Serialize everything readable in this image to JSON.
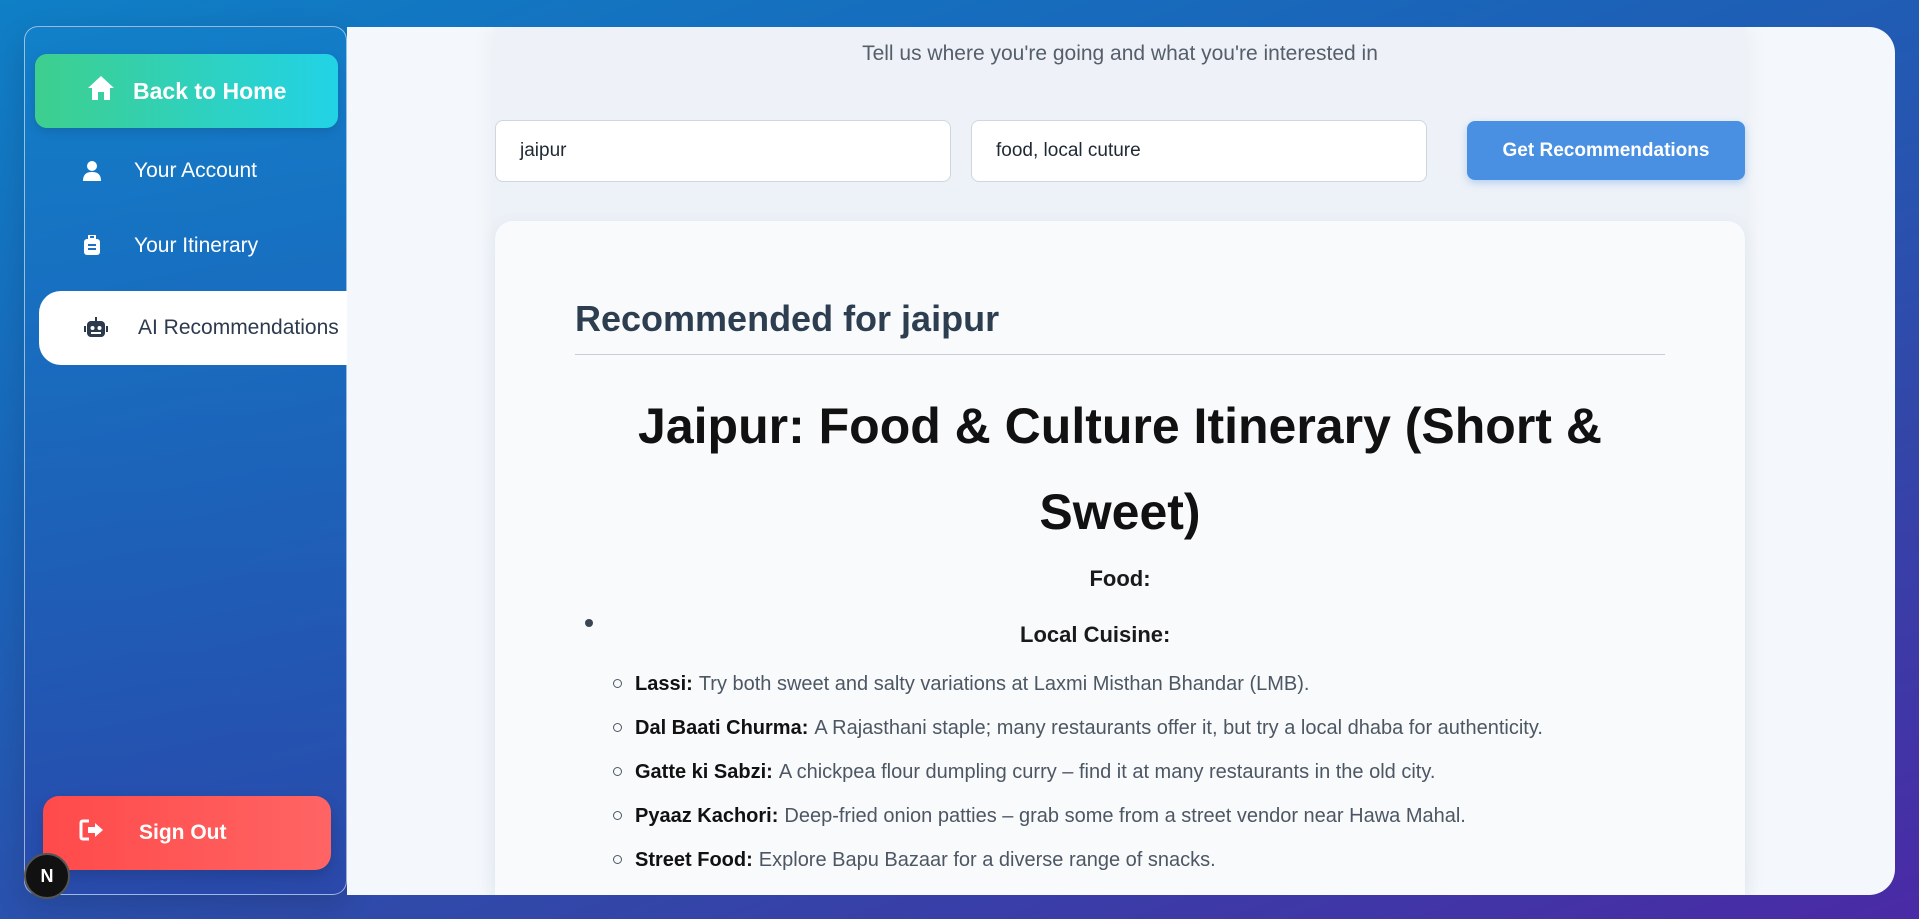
{
  "sidebar": {
    "back_label": "Back to Home",
    "items": [
      {
        "label": "Your Account",
        "icon": "user-icon"
      },
      {
        "label": "Your Itinerary",
        "icon": "luggage-icon"
      },
      {
        "label": "AI Recommendations",
        "icon": "robot-icon",
        "active": true
      }
    ],
    "signout_label": "Sign Out",
    "badge": "N"
  },
  "main": {
    "subtitle": "Tell us where you're going and what you're interested in",
    "destination_value": "jaipur",
    "interests_value": "food, local cuture",
    "get_button": "Get Recommendations",
    "result": {
      "heading": "Recommended for jaipur",
      "doc_title": "Jaipur: Food & Culture Itinerary (Short & Sweet)",
      "food_label": "Food:",
      "cuisine_label": "Local Cuisine:",
      "items": [
        {
          "key": "Lassi:",
          "text": "Try both sweet and salty variations at Laxmi Misthan Bhandar (LMB)."
        },
        {
          "key": "Dal Baati Churma:",
          "text": "A Rajasthani staple; many restaurants offer it, but try a local dhaba for authenticity."
        },
        {
          "key": "Gatte ki Sabzi:",
          "text": "A chickpea flour dumpling curry – find it at many restaurants in the old city."
        },
        {
          "key": "Pyaaz Kachori:",
          "text": "Deep-fried onion patties – grab some from a street vendor near Hawa Mahal."
        },
        {
          "key": "Street Food:",
          "text": "Explore Bapu Bazaar for a diverse range of snacks."
        }
      ]
    }
  },
  "colors": {
    "accent": "#4a90e2",
    "back_gradient_start": "#3ecf8e",
    "back_gradient_end": "#22d3e6",
    "signout": "#ff5555"
  }
}
